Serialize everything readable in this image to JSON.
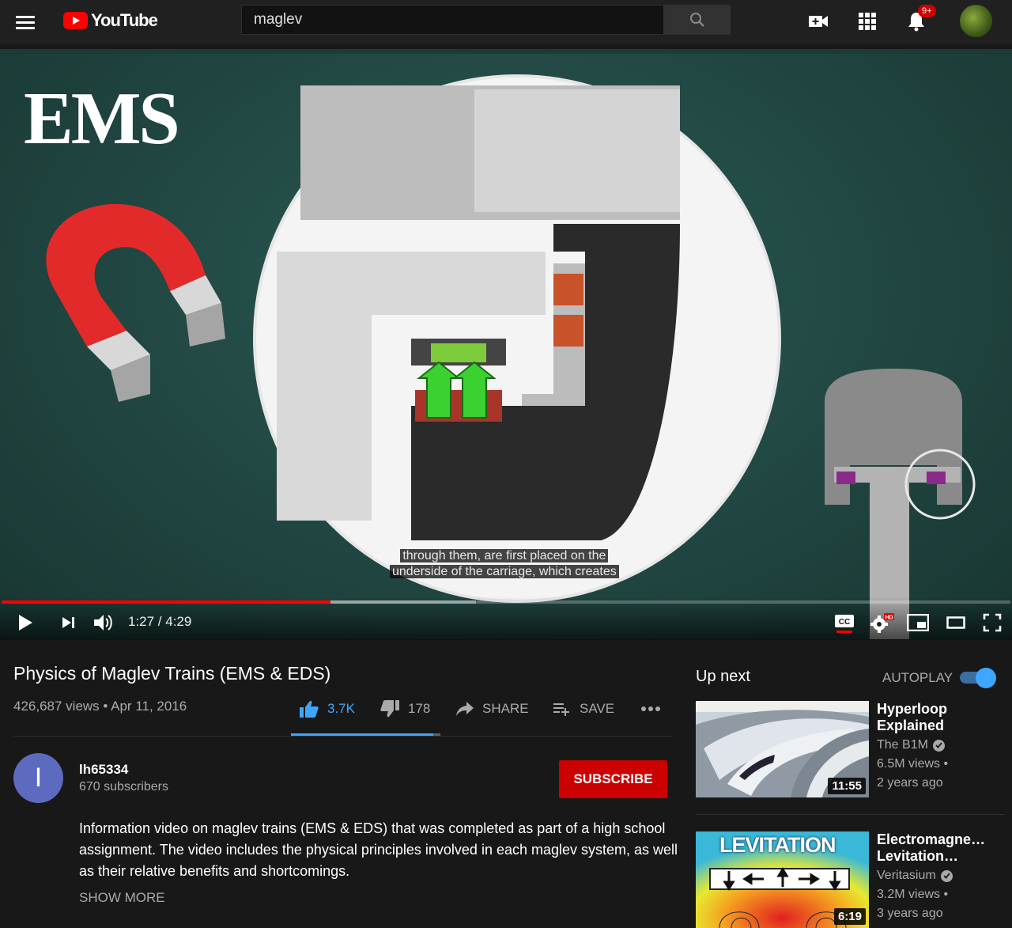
{
  "header": {
    "logo_text": "YouTube",
    "search_value": "maglev",
    "notifications_badge": "9+"
  },
  "player": {
    "overlay_title": "EMS",
    "caption_line1": "through them, are first placed on the",
    "caption_line2": "underside of the carriage, which creates",
    "time_display": "1:27 / 4:29",
    "played_fraction": 0.326,
    "buffered_fraction": 0.47,
    "colors": {
      "progress": "#ff0000",
      "board": "#234a45"
    }
  },
  "video": {
    "title": "Physics of Maglev Trains (EMS & EDS)",
    "views_date": "426,687 views • Apr 11, 2016",
    "likes": "3.7K",
    "dislikes": "178",
    "share_label": "SHARE",
    "save_label": "SAVE",
    "like_fraction": 0.95
  },
  "owner": {
    "avatar_letter": "I",
    "name": "lh65334",
    "subscribers": "670 subscribers",
    "subscribe_label": "SUBSCRIBE"
  },
  "description": {
    "text": "Information video on maglev trains (EMS & EDS) that was completed as part of a high school assignment. The video includes the physical principles involved in each maglev system, as well as their relative benefits and shortcomings.",
    "show_more": "SHOW MORE"
  },
  "sidebar": {
    "up_next": "Up next",
    "autoplay": "AUTOPLAY",
    "autoplay_on": true,
    "items": [
      {
        "title": "Hyperloop Explained",
        "channel": "The B1M",
        "views": "6.5M views •",
        "age": "2 years ago",
        "duration": "11:55"
      },
      {
        "title": "Electromagne… Levitation…",
        "channel": "Veritasium",
        "views": "3.2M views •",
        "age": "3 years ago",
        "duration": "6:19",
        "thumb_text": "LEVITATION"
      }
    ]
  }
}
